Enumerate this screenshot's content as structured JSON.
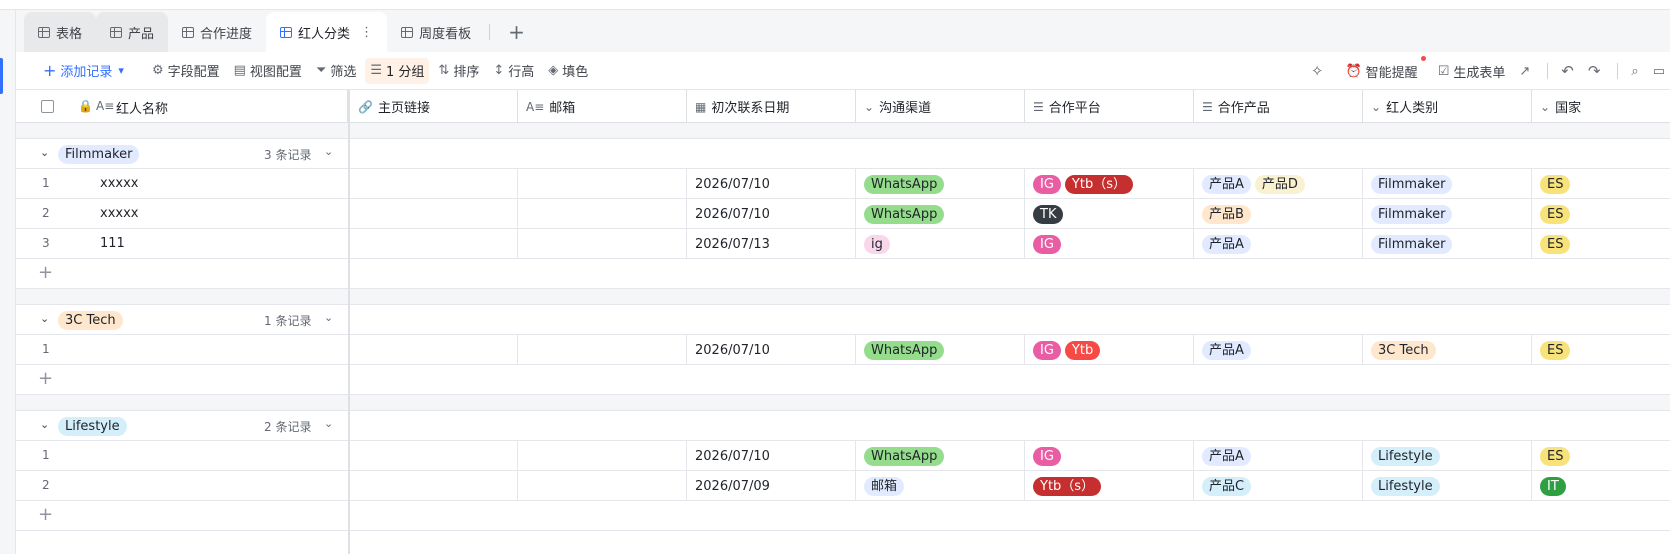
{
  "tabs": [
    {
      "label": "表格",
      "state": "hover"
    },
    {
      "label": "产品",
      "state": "hover"
    },
    {
      "label": "合作进度",
      "state": "normal"
    },
    {
      "label": "红人分类",
      "state": "active"
    },
    {
      "label": "周度看板",
      "state": "normal"
    }
  ],
  "tab_more": "⋮",
  "tab_add": "+",
  "toolbar": {
    "add_record": "添加记录",
    "field_config": "字段配置",
    "view_config": "视图配置",
    "filter": "筛选",
    "group": "1 分组",
    "sort": "排序",
    "row_height": "行高",
    "fill": "填色",
    "smart_remind": "智能提醒",
    "gen_form": "生成表单"
  },
  "columns": [
    {
      "label": "红人名称",
      "icon": "text-icon"
    },
    {
      "label": "主页链接",
      "icon": "link-icon"
    },
    {
      "label": "邮箱",
      "icon": "text-icon"
    },
    {
      "label": "初次联系日期",
      "icon": "calendar-icon"
    },
    {
      "label": "沟通渠道",
      "icon": "single-select-icon"
    },
    {
      "label": "合作平台",
      "icon": "multi-select-icon"
    },
    {
      "label": "合作产品",
      "icon": "multi-select-icon"
    },
    {
      "label": "红人类别",
      "icon": "single-select-icon"
    },
    {
      "label": "国家",
      "icon": "single-select-icon"
    }
  ],
  "colors": {
    "Filmmaker": "#e1eaff",
    "3C Tech": "#fee7cd",
    "Lifestyle": "#d4eefa",
    "WhatsApp": "#95dd8c",
    "ig_channel": "#fad6ea",
    "邮箱": "#e1eaff",
    "IG": "#e85da3",
    "Ytb": "#f54a45",
    "Ytb（s）": "#c62f2f",
    "TK": "#373c43",
    "产品A": "#e1eaff",
    "产品B": "#fee7cd",
    "产品C": "#d4eefa",
    "产品D": "#faf1d1",
    "ES": "#f8e27a",
    "IT": "#2ea043"
  },
  "groups": [
    {
      "name": "Filmmaker",
      "count": "3 条记录",
      "rows": [
        {
          "index": "1",
          "name": "xxxxx",
          "date": "2026/07/10",
          "channel": "WhatsApp",
          "platforms": [
            "IG",
            "Ytb（s）"
          ],
          "products": [
            "产品A",
            "产品D"
          ],
          "category": "Filmmaker",
          "country": "ES"
        },
        {
          "index": "2",
          "name": "xxxxx",
          "date": "2026/07/10",
          "channel": "WhatsApp",
          "platforms": [
            "TK"
          ],
          "products": [
            "产品B"
          ],
          "category": "Filmmaker",
          "country": "ES"
        },
        {
          "index": "3",
          "name": "111",
          "date": "2026/07/13",
          "channel": "ig",
          "platforms": [
            "IG"
          ],
          "products": [
            "产品A"
          ],
          "category": "Filmmaker",
          "country": "ES"
        }
      ]
    },
    {
      "name": "3C Tech",
      "count": "1 条记录",
      "rows": [
        {
          "index": "1",
          "name": "",
          "date": "2026/07/10",
          "channel": "WhatsApp",
          "platforms": [
            "IG",
            "Ytb"
          ],
          "products": [
            "产品A"
          ],
          "category": "3C Tech",
          "country": "ES"
        }
      ]
    },
    {
      "name": "Lifestyle",
      "count": "2 条记录",
      "rows": [
        {
          "index": "1",
          "name": "",
          "date": "2026/07/10",
          "channel": "WhatsApp",
          "platforms": [
            "IG"
          ],
          "products": [
            "产品A"
          ],
          "category": "Lifestyle",
          "country": "ES"
        },
        {
          "index": "2",
          "name": "",
          "date": "2026/07/09",
          "channel": "邮箱",
          "platforms": [
            "Ytb（s）"
          ],
          "products": [
            "产品C"
          ],
          "category": "Lifestyle",
          "country": "IT"
        }
      ]
    }
  ]
}
